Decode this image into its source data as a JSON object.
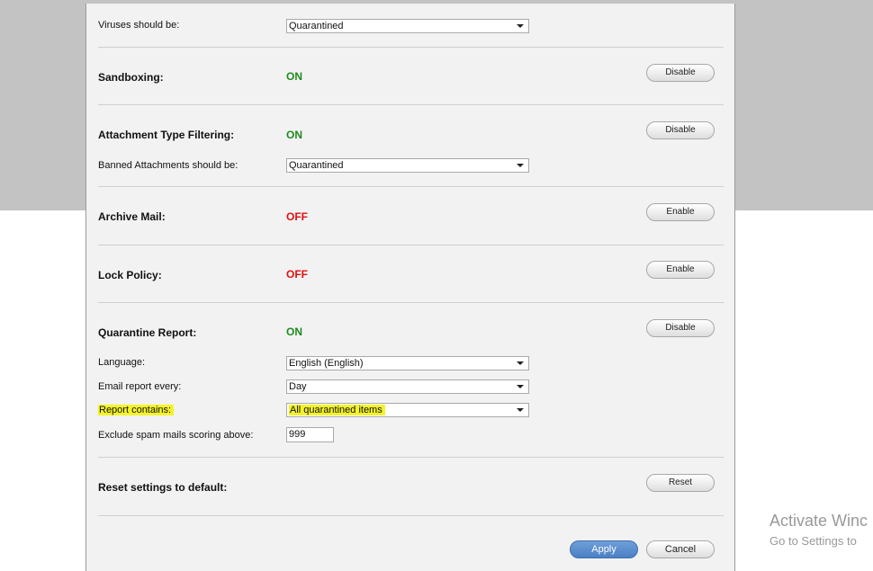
{
  "settings": {
    "viruses": {
      "label": "Viruses should be:",
      "value": "Quarantined"
    },
    "sandboxing": {
      "label": "Sandboxing:",
      "status": "ON",
      "action": "Disable"
    },
    "attachment_filtering": {
      "label": "Attachment Type Filtering:",
      "status": "ON",
      "action": "Disable",
      "banned": {
        "label": "Banned Attachments should be:",
        "value": "Quarantined"
      }
    },
    "archive_mail": {
      "label": "Archive Mail:",
      "status": "OFF",
      "action": "Enable"
    },
    "lock_policy": {
      "label": "Lock Policy:",
      "status": "OFF",
      "action": "Enable"
    },
    "quarantine_report": {
      "label": "Quarantine Report:",
      "status": "ON",
      "action": "Disable",
      "language": {
        "label": "Language:",
        "value": "English (English)"
      },
      "email_every": {
        "label": "Email report every:",
        "value": "Day"
      },
      "report_contains": {
        "label": "Report contains:",
        "value": "All quarantined items"
      },
      "exclude_spam": {
        "label": "Exclude spam mails scoring above:",
        "value": "999"
      }
    },
    "reset": {
      "label": "Reset settings to default:",
      "action": "Reset"
    }
  },
  "footer": {
    "apply": "Apply",
    "cancel": "Cancel"
  },
  "watermark": {
    "line1": "Activate Winc",
    "line2": "Go to Settings to"
  },
  "colors": {
    "on": "#1e8a1e",
    "off": "#e01010",
    "highlight": "#f4f32a",
    "apply": "#4b80c4"
  }
}
